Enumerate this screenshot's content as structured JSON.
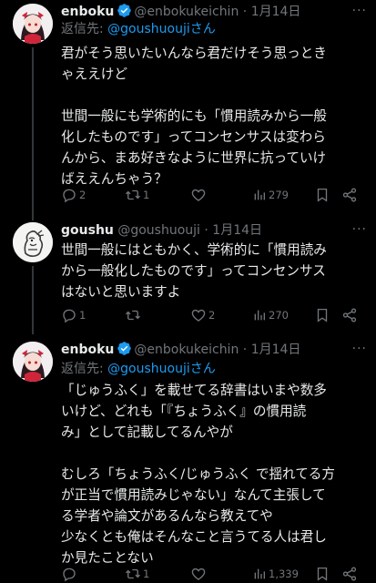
{
  "colors": {
    "background": "#000000",
    "text": "#e7e9ea",
    "muted": "#71767b",
    "link": "#1d9bf0",
    "verified": "#1d9bf0",
    "divider": "#2f3336"
  },
  "tweets": [
    {
      "author": "enboku",
      "handle": "@enbokukeichin",
      "separator": "·",
      "date": "1月14日",
      "verified": true,
      "reply_prefix": "返信先: ",
      "reply_to": "@goushuoujiさん",
      "lines": [
        "君がそう思いたいんなら君だけそう思っとき",
        "ゃええけど",
        "",
        "世間一般にも学術的にも「慣用読みから一般",
        "化したものです」ってコンセンサスは変わら",
        "んから、まあ好きなように世界に抗っていけ",
        "ばええんちゃう？"
      ],
      "stats": {
        "replies": "2",
        "retweets": "1",
        "likes": "",
        "views": "279"
      }
    },
    {
      "author": "goushu",
      "handle": "@goushuouji",
      "separator": "·",
      "date": "1月14日",
      "verified": false,
      "lines": [
        "世間一般にはともかく、学術的に「慣用読み",
        "から一般化したものです」ってコンセンサス",
        "はないと思いますよ"
      ],
      "stats": {
        "replies": "1",
        "retweets": "",
        "likes": "2",
        "views": "270"
      }
    },
    {
      "author": "enboku",
      "handle": "@enbokukeichin",
      "separator": "·",
      "date": "1月14日",
      "verified": true,
      "reply_prefix": "返信先: ",
      "reply_to": "@goushuoujiさん",
      "lines": [
        "「じゅうふく」を載せてる辞書はいまや数多",
        "いけど、どれも「『ちょうふく』の慣用読",
        "み」として記載してるんやが",
        "",
        "むしろ「ちょうふく/じゅうふく で揺れてる方",
        "が正当で慣用読みじゃない」なんて主張して",
        "る学者や論文があるんなら教えてや",
        "少なくとも俺はそんなこと言うてる人は君し",
        "か見たことない"
      ],
      "stats": {
        "replies": "",
        "retweets": "1",
        "likes": "",
        "views": "1,339"
      }
    }
  ]
}
